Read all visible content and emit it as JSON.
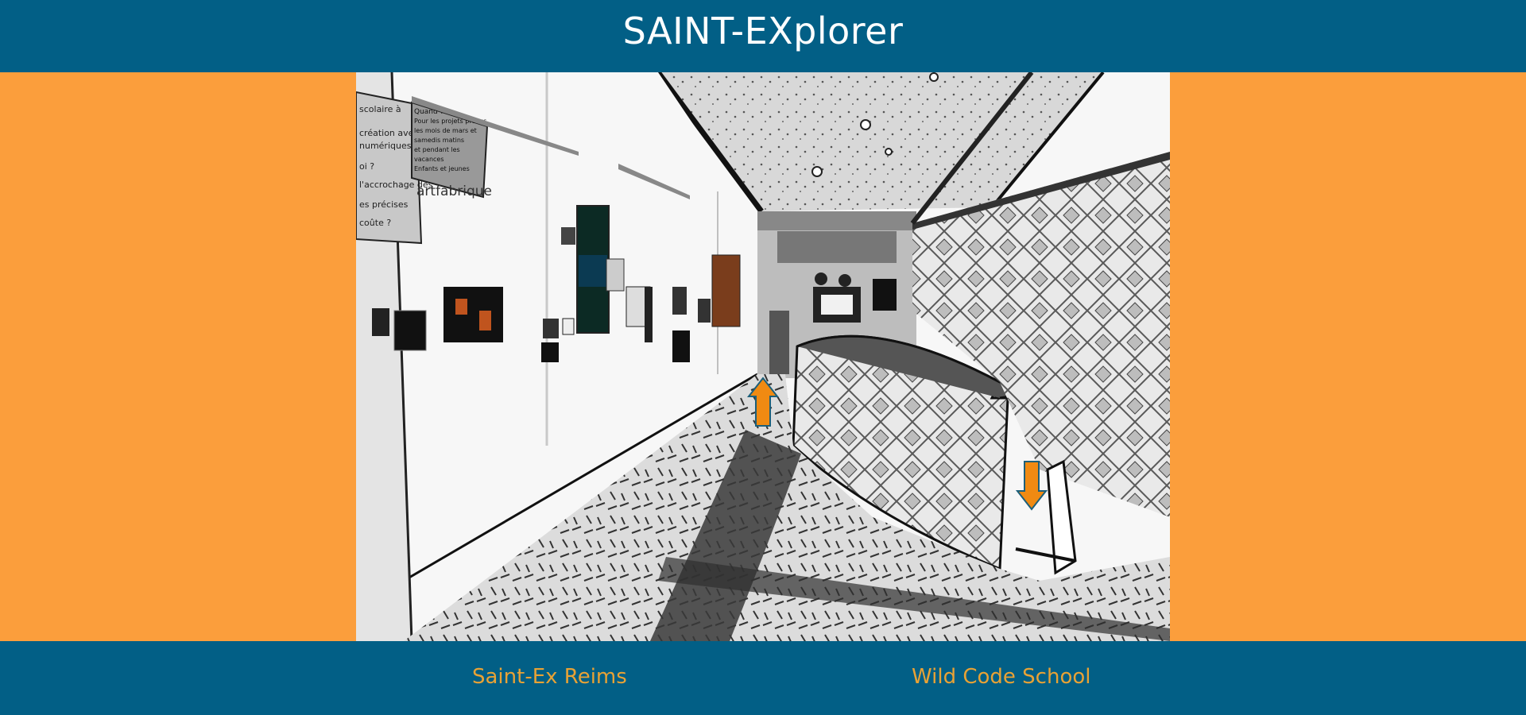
{
  "header": {
    "title": "SAINT-EXplorer"
  },
  "footer": {
    "left_link": "Saint-Ex Reims",
    "right_link": "Wild Code School"
  },
  "panorama": {
    "wall_poster_lines": [
      "scolaire à",
      "création avec",
      "numériques",
      "oi ?",
      "l'accrochage des",
      "es précises",
      "coûte ?"
    ],
    "wall_panel_lines": [
      "Quand ?",
      "Pour les projets prévus",
      "les mois de mars et",
      "samedis matins",
      "et pendant les",
      "vacances",
      "Enfants et jeunes"
    ],
    "wall_brand": "artfabrique",
    "navigation": [
      {
        "icon": "arrow-up-icon",
        "direction": "forward"
      },
      {
        "icon": "arrow-down-icon",
        "direction": "backward"
      }
    ]
  },
  "colors": {
    "header_bg": "#025f86",
    "page_bg": "#fb9e3c",
    "footer_link": "#e8a235",
    "arrow": "#f08a12"
  }
}
